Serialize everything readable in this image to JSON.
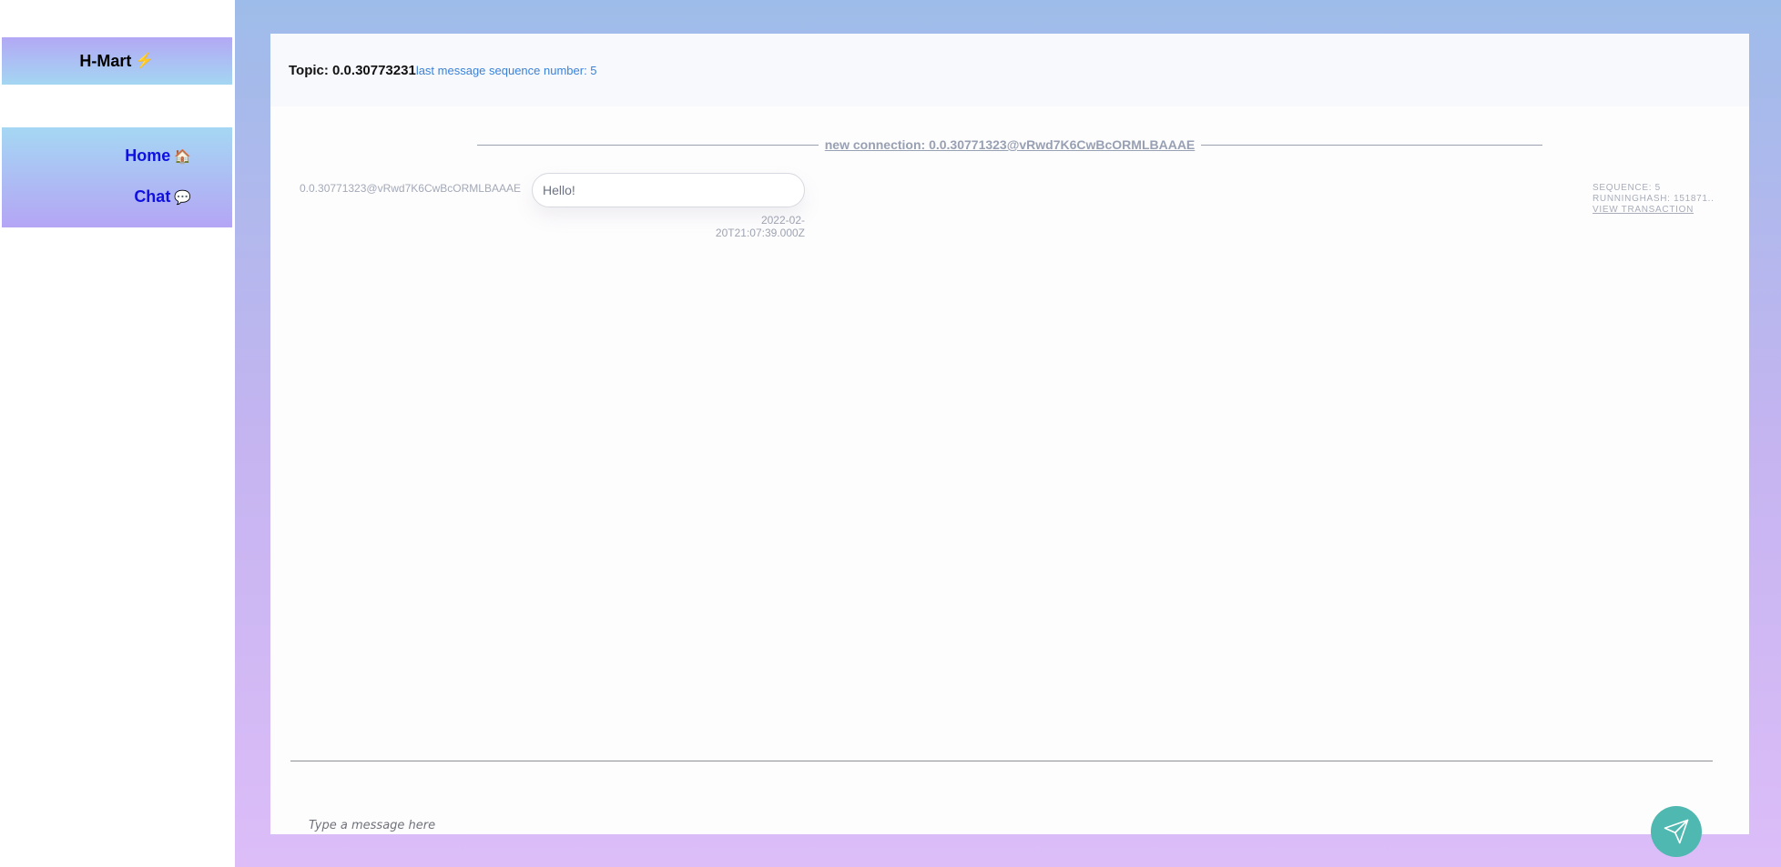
{
  "sidebar": {
    "brand": {
      "name": "H-Mart",
      "icon": "lightning-bolt-icon",
      "glyph": "⚡"
    },
    "nav": [
      {
        "label": "Home",
        "icon": "house-icon",
        "glyph": "🏠"
      },
      {
        "label": "Chat",
        "icon": "speech-bubble-icon",
        "glyph": "💬"
      }
    ]
  },
  "header": {
    "topic": "Topic: 0.0.30773231",
    "sequence": "last message sequence number: 5"
  },
  "chat": {
    "connection": "new connection: 0.0.30771323@vRwd7K6CwBcORMLBAAAE",
    "messages": [
      {
        "sender": "0.0.30771323@vRwd7K6CwBcORMLBAAAE",
        "text": "Hello!",
        "timestamp": "2022-02-20T21:07:39.000Z",
        "sequence": "SEQUENCE: 5",
        "running_hash": "RUNNINGHASH: 151871..",
        "link": "VIEW TRANSACTION"
      }
    ]
  },
  "composer": {
    "placeholder": "Type a message here",
    "value": "",
    "send_icon": "paper-plane-icon"
  },
  "colors": {
    "accent": "#4fb8b0",
    "nav_link": "#1010e0",
    "sequence_text": "#3b82d6"
  }
}
